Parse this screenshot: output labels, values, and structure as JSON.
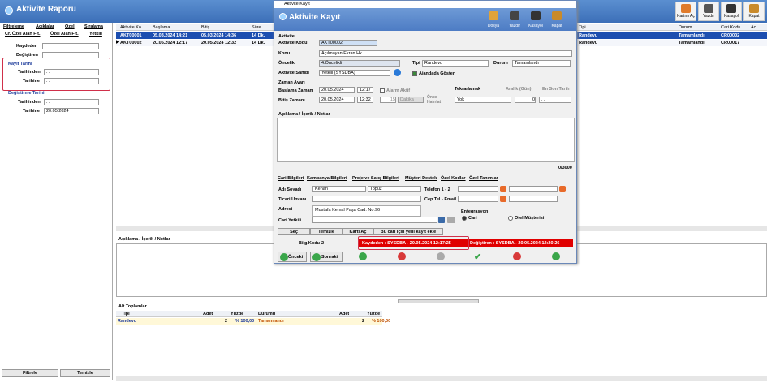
{
  "app": {
    "title": "Aktivite Raporu"
  },
  "toolbar": [
    {
      "label": "Kartını Aç",
      "icon": "open-card-icon"
    },
    {
      "label": "Yazdır",
      "icon": "printer-icon"
    },
    {
      "label": "Kasayol",
      "icon": "cash-icon"
    },
    {
      "label": "Kapat",
      "icon": "close-door-icon"
    }
  ],
  "left": {
    "tabs": [
      "Filtreleme",
      "Açıklalar",
      "Özel",
      "Sıralama"
    ],
    "tabs2": [
      "Cr. Özel Alan Flt.",
      "Özel Alan Flt.",
      "Yetkili"
    ],
    "kaydeden": "Kaydeden",
    "degistiren": "Değiştiren",
    "kayit_tarihi": "Kayıt Tarihi",
    "tarihinden": "Tarihinden",
    "tarihine": "Tarihine",
    "date_empty": ". .",
    "degistirme_tarihi": "Değiştirme Tarihi",
    "d_tarihine_val": "20.05.2024",
    "filtrele": "Filtrele",
    "temizle": "Temizle"
  },
  "grid": {
    "headers": [
      "Aktivite Ko...",
      "Başlama",
      "Bitiş",
      "Süre"
    ],
    "right_headers": [
      "Tipi",
      "Durum",
      "Cari Kodu",
      "Ac"
    ],
    "rows": [
      {
        "kod": "AKT00001",
        "bas": "05.03.2024 14:21",
        "bit": "05.03.2024 14:36",
        "sure": "14 Dk.",
        "tipi": "Randevu",
        "durum": "Tamamlandı",
        "cari": "CR00002"
      },
      {
        "kod": "AKT00002",
        "bas": "20.05.2024 12:17",
        "bit": "20.05.2024 12:32",
        "sure": "14 Dk.",
        "tipi": "Randevu",
        "durum": "Tamamlandı",
        "cari": "CR00017"
      }
    ]
  },
  "desc": {
    "label": "Açıklama / İçerik / Notlar"
  },
  "totals": {
    "title": "Alt Toplamlar",
    "headers": [
      "Tipi",
      "Adet",
      "Yüzde",
      "Durumu",
      "Adet",
      "Yüzde"
    ],
    "row": [
      "Randevu",
      "2",
      "% 100,00",
      "Tamamlandı",
      "2",
      "% 100,00"
    ]
  },
  "dialog": {
    "window_title": "Aktivite Kayıt",
    "title": "Aktivite Kayıt",
    "tools": [
      "Dosya",
      "Yazdır",
      "Kasayol",
      "Kapat"
    ],
    "aktivite": "Aktivite",
    "kod_label": "Aktivite Kodu",
    "kod_val": "AKT00002",
    "konu_label": "Konu",
    "konu_val": "Açılmayan Ekran Hk.",
    "oncelik_label": "Öncelik",
    "oncelik_val": "4.Öncelikli",
    "tipi_label": "Tipi",
    "tipi_val": "Randevu",
    "durum_label": "Durum",
    "durum_val": "Tamamlandı",
    "sahibi_label": "Aktivite Sahibi",
    "sahibi_val": "Yetkili (SYSDBA)",
    "ajanda": "Ajandada Göster",
    "zaman": "Zaman Ayarı",
    "bas_label": "Başlama Zamanı",
    "bas_date": "20.05.2024",
    "bas_time": "12:17",
    "bit_label": "Bitiş Zamanı",
    "bit_date": "20.05.2024",
    "bit_time": "12:32",
    "alarm": "Alarm Aktif",
    "alarm_num": "15",
    "dakika": "Dakika",
    "once": "Önce Hatırlat",
    "tekrar": "Tekrarlamak",
    "aralik": "Aralık (Gün)",
    "en_son": "En Son Tarih",
    "yok": "Yok",
    "aralik_val": "0",
    "en_son_val": ". .",
    "notlar": "Açıklama / İçerik / Notlar",
    "counter": "0/3000",
    "tabs": [
      "Cari Bilgileri",
      "Kampanya Bilgileri",
      "Proje ve Satış Bilgileri",
      "Müşteri Destek",
      "Özel Kodlar",
      "Özel Tanımlar"
    ],
    "adi_label": "Adı Soyadı",
    "adi_val": "Kenan",
    "soyadi_val": "Topuz",
    "telefon_label": "Telefon 1 - 2",
    "unvan_label": "Ticari Unvanı",
    "cep_label": "Cep Tel - Email",
    "adres_label": "Adresi",
    "adres_val": "Mustafa Kemal Paşa Cad. No:96",
    "entegrasyon": "Entegrasyon",
    "cari": "Cari",
    "otel": "Otel Müşterisi",
    "cari_yetkili": "Cari Yetkili",
    "btn_sec": "Seç",
    "btn_temizle": "Temizle",
    "btn_karti": "Kartı Aç",
    "btn_yeni": "Bu cari için yeni kayıt ekle",
    "bilg_label": "Bilg.Kodu",
    "bilg_val": "2",
    "kaydeden": "Kaydeden : SYSDBA - 20.05.2024 12:17:25",
    "degistiren": "Değiştiren : SYSDBA - 20.05.2024 12:20:26",
    "onceki": "Önceki",
    "sonraki": "Sonraki"
  },
  "colors": {
    "header": "#4a7cc4",
    "selected": "#1d4fb0",
    "red": "#e00000",
    "green": "#3aa64a"
  }
}
